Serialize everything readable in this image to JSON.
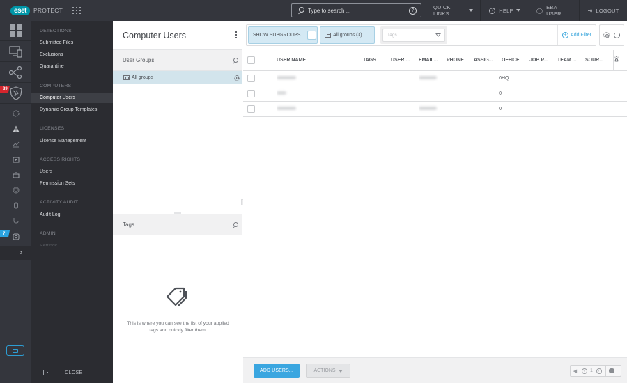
{
  "topbar": {
    "logo": "eset",
    "product": "PROTECT",
    "search_placeholder": "Type to search ...",
    "quick_links": "QUICK LINKS",
    "help": "HELP",
    "user": "EBA USER",
    "logout": "LOGOUT"
  },
  "rail": {
    "icons": [
      "dashboard-icon",
      "computers-icon",
      "tasks-icon",
      "detections-icon",
      "status-icon",
      "alerts-icon",
      "reports-icon",
      "installers-icon",
      "policies-icon",
      "notifications-icon",
      "status-overview-icon",
      "more-icon",
      "settings-icon"
    ],
    "badges": {
      "detections": "89",
      "admin": "7"
    },
    "more": "···"
  },
  "nav": {
    "sections": [
      {
        "heading": "DETECTIONS",
        "items": [
          "Submitted Files",
          "Exclusions",
          "Quarantine"
        ]
      },
      {
        "heading": "COMPUTERS",
        "items": [
          "Computer Users",
          "Dynamic Group Templates"
        ]
      },
      {
        "heading": "LICENSES",
        "items": [
          "License Management"
        ]
      },
      {
        "heading": "ACCESS RIGHTS",
        "items": [
          "Users",
          "Permission Sets"
        ]
      },
      {
        "heading": "ACTIVITY AUDIT",
        "items": [
          "Audit Log"
        ]
      },
      {
        "heading": "ADMIN",
        "items": [
          "Settings"
        ]
      }
    ],
    "active_item": "Computer Users",
    "close": "CLOSE"
  },
  "middle": {
    "title": "Computer Users",
    "groups_header": "User Groups",
    "group_item": "All groups",
    "tags_header": "Tags",
    "tags_empty": "This is where you can see the list of your applied tags and quickly filter them."
  },
  "filters": {
    "show_subgroups": "SHOW SUBGROUPS",
    "group_chip": "All groups (3)",
    "tags_placeholder": "Tags...",
    "add_filter": "Add Filter"
  },
  "table": {
    "columns": [
      "USER NAME",
      "TAGS",
      "USER ...",
      "EMAIL...",
      "PHONE",
      "ASSIG...",
      "OFFICE",
      "JOB P...",
      "TEAM ...",
      "SOUR..."
    ],
    "rows": [
      {
        "user_name": "[blurred]",
        "email": "[blurred]",
        "assigned": "0",
        "office": "HQ"
      },
      {
        "user_name": "[blurred]",
        "email": "",
        "assigned": "0",
        "office": ""
      },
      {
        "user_name": "[blurred]",
        "email": "[blurred]",
        "assigned": "0",
        "office": ""
      }
    ]
  },
  "footer": {
    "add_users": "ADD USERS...",
    "actions": "ACTIONS",
    "page": "1"
  },
  "colors": {
    "accent": "#3aa6e0",
    "brand": "#0096a8",
    "badge_red": "#d5252d",
    "badge_blue": "#2ba3df",
    "selected_row": "#d2e4ec"
  }
}
